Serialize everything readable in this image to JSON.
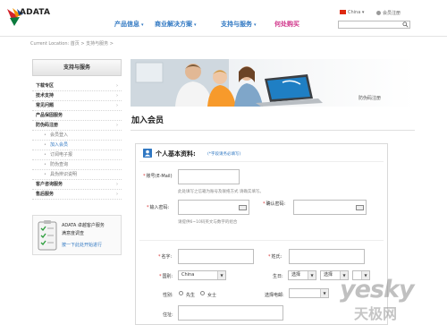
{
  "header": {
    "logo_text": "ADATA",
    "nav": [
      {
        "label": "产品信息",
        "active": false
      },
      {
        "label": "商业解决方案",
        "active": false
      },
      {
        "label": "支持与服务",
        "active": false
      },
      {
        "label": "何处购买",
        "active": true
      }
    ],
    "region": "China",
    "member_login": "会员注册",
    "search": {
      "placeholder": ""
    }
  },
  "breadcrumb": "Current Location: 首页 > 支持与服务 >",
  "sidebar": {
    "title": "支持与服务",
    "items": [
      {
        "label": "下载专区",
        "type": "main",
        "arrow": "›"
      },
      {
        "label": "技术支持",
        "type": "main",
        "arrow": "›"
      },
      {
        "label": "常见问题",
        "type": "main",
        "arrow": "›"
      },
      {
        "label": "产品保固服务",
        "type": "main",
        "arrow": ""
      },
      {
        "label": "防伪码注册",
        "type": "main",
        "arrow": "›"
      },
      {
        "label": "会员登入",
        "type": "sub",
        "active": false
      },
      {
        "label": "加入会员",
        "type": "sub",
        "active": true
      },
      {
        "label": "订阅电子报",
        "type": "sub",
        "active": false
      },
      {
        "label": "防伪查询",
        "type": "sub",
        "active": false
      },
      {
        "label": "具伪辨识说明",
        "type": "sub",
        "active": false
      },
      {
        "label": "客户咨询服务",
        "type": "main",
        "arrow": "›"
      },
      {
        "label": "售后服务",
        "type": "main",
        "arrow": "›"
      }
    ],
    "survey": {
      "line1": "ADATA 卓越客户服务",
      "line2": "满意度调查",
      "link": "按一下此处开始进行"
    }
  },
  "banner": {
    "label": "防伪码注册"
  },
  "main": {
    "title": "加入会员",
    "section": {
      "title": "个人基本资料:",
      "note": "(*字段请务必填写)"
    },
    "fields": {
      "account_label": "账号(E-Mail)",
      "account_hint": "此处填写之信箱为账号及联络方式 请确实填写。",
      "password_label": "输入密码:",
      "password_confirm_label": "确认密码:",
      "password_hint": "请提供6~10码英文与数字的组合",
      "first_name_label": "名字:",
      "last_name_label": "姓氏:",
      "country_label": "国别:",
      "country_value": "China",
      "birthday_label": "生日:",
      "birthday_select1": "选择",
      "birthday_select2": "选择",
      "gender_label": "性别:",
      "gender_male": "先生",
      "gender_female": "女士",
      "email_pref_label": "选择电邮:",
      "address_label": "住址:"
    }
  },
  "watermark": {
    "line1": "yesky",
    "line2": "天极网"
  },
  "colors": {
    "brand_blue": "#2f77c2",
    "brand_pink": "#d0348a",
    "required_red": "#d63030"
  }
}
